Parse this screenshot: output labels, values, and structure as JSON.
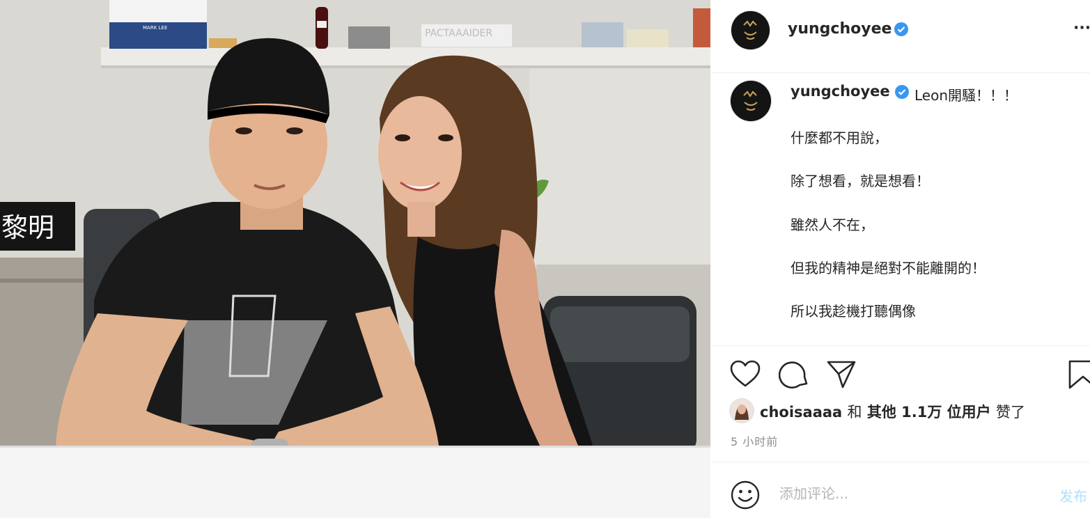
{
  "post": {
    "username": "yungchoyee",
    "more_label": "···",
    "caption": {
      "username": "yungchoyee",
      "first_line": "Leon開騷！！！",
      "lines": [
        "什麼都不用說，",
        "除了想看，就是想看！",
        "雖然人不在，",
        "但我的精神是絕對不能離開的！",
        "所以我趁機打聽偶像"
      ]
    },
    "likes": {
      "user": "choisaaaa",
      "conj": "和",
      "others": "其他 1.1万 位用户",
      "suffix": "赞了"
    },
    "time_ago": "5 小时前",
    "comment": {
      "placeholder": "添加评论...",
      "post_label": "发布"
    }
  },
  "photo": {
    "name_sign": "黎明",
    "box_label": "MARK LEE",
    "shelf_letters": "PACTAAAIDER"
  },
  "colors": {
    "verified": "#3897f0",
    "post_button": "#b2dffc",
    "muted": "#8e8e8e",
    "text": "#262626"
  },
  "icons": [
    "heart-icon",
    "comment-icon",
    "share-icon",
    "bookmark-icon",
    "emoji-icon",
    "verified-badge-icon",
    "more-options-icon"
  ]
}
